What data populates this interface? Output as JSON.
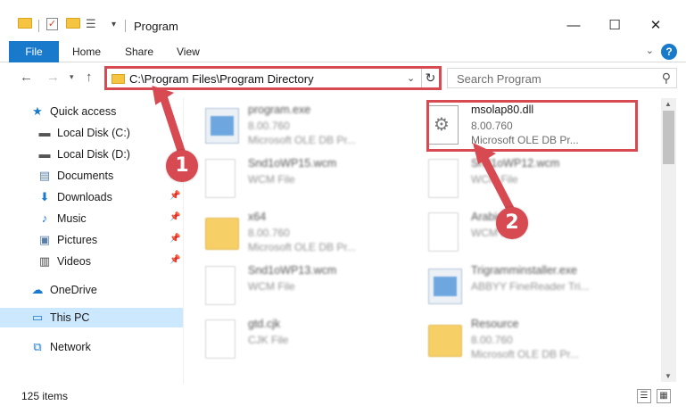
{
  "window": {
    "title": "Program",
    "minimize": "—",
    "maximize": "☐",
    "close": "✕"
  },
  "ribbon": {
    "tabs": [
      {
        "label": "File"
      },
      {
        "label": "Home"
      },
      {
        "label": "Share"
      },
      {
        "label": "View"
      }
    ],
    "help": "?"
  },
  "address": {
    "path": "C:\\Program Files\\Program Directory",
    "search_placeholder": "Search Program"
  },
  "sidebar": {
    "items": [
      {
        "label": "Quick access",
        "icon": "star-icon",
        "pinned": false
      },
      {
        "label": "Local Disk (C:)",
        "icon": "drive-icon",
        "pinned": false
      },
      {
        "label": "Local Disk (D:)",
        "icon": "drive-icon",
        "pinned": false
      },
      {
        "label": "Documents",
        "icon": "documents-icon",
        "pinned": true
      },
      {
        "label": "Downloads",
        "icon": "download-icon",
        "pinned": true
      },
      {
        "label": "Music",
        "icon": "music-icon",
        "pinned": true
      },
      {
        "label": "Pictures",
        "icon": "pictures-icon",
        "pinned": true
      },
      {
        "label": "Videos",
        "icon": "videos-icon",
        "pinned": true
      },
      {
        "label": "OneDrive",
        "icon": "cloud-icon",
        "pinned": false
      },
      {
        "label": "This PC",
        "icon": "computer-icon",
        "pinned": false,
        "selected": true
      },
      {
        "label": "Network",
        "icon": "network-icon",
        "pinned": false
      }
    ]
  },
  "files": [
    {
      "name": "program.exe",
      "meta1": "8.00.760",
      "meta2": "Microsoft OLE DB Pr...",
      "icon": "exe-icon"
    },
    {
      "name": "msolap80.dll",
      "meta1": "8.00.760",
      "meta2": "Microsoft OLE DB Pr...",
      "icon": "dll-icon"
    },
    {
      "name": "Snd1oWP15.wcm",
      "meta1": "WCM File",
      "meta2": "",
      "icon": "document-icon"
    },
    {
      "name": "Snd1oWP12.wcm",
      "meta1": "WCM File",
      "meta2": "",
      "icon": "document-icon"
    },
    {
      "name": "x64",
      "meta1": "8.00.760",
      "meta2": "Microsoft OLE DB Pr...",
      "icon": "folder-icon"
    },
    {
      "name": "Arabic",
      "meta1": "WCM File",
      "meta2": "",
      "icon": "document-icon"
    },
    {
      "name": "Snd1oWP13.wcm",
      "meta1": "WCM File",
      "meta2": "",
      "icon": "document-icon"
    },
    {
      "name": "Trigramminstaller.exe",
      "meta1": "ABBYY FineReader Tri...",
      "meta2": "",
      "icon": "exe-icon"
    },
    {
      "name": "gtd.cjk",
      "meta1": "CJK File",
      "meta2": "",
      "icon": "document-icon"
    },
    {
      "name": "Resource",
      "meta1": "8.00.760",
      "meta2": "Microsoft OLE DB Pr...",
      "icon": "folder-icon"
    }
  ],
  "status": {
    "item_count": "125 items"
  },
  "annotations": {
    "step1": "1",
    "step2": "2",
    "color": "#d84a52"
  }
}
